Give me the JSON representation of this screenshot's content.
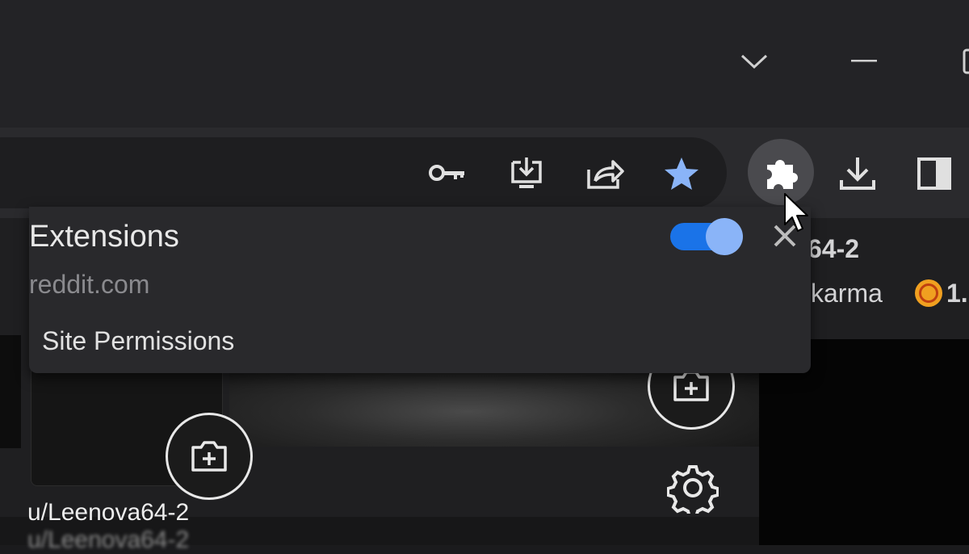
{
  "popup": {
    "title": "Extensions",
    "site": "reddit.com",
    "site_permissions": "Site Permissions",
    "toggle_on": true
  },
  "page": {
    "username_partial": "64-2",
    "karma_label": "karma",
    "karma_value": "1.",
    "post_username": "u/Leenova64-2",
    "post_username_repeat": "u/Leenova64-2"
  },
  "colors": {
    "accent": "#1a73e8",
    "toggle_knob": "#8ab4f8",
    "bookmark_star": "#8ab4f8",
    "coin": "#f0a020"
  },
  "icons": [
    "chevron-down-icon",
    "minimize-icon",
    "maximize-icon",
    "key-icon",
    "install-app-icon",
    "share-icon",
    "bookmark-star-icon",
    "extensions-puzzle-icon",
    "download-icon",
    "side-panel-icon",
    "close-icon",
    "add-image-icon",
    "gear-icon",
    "mouse-cursor-icon",
    "karma-coin-icon"
  ]
}
